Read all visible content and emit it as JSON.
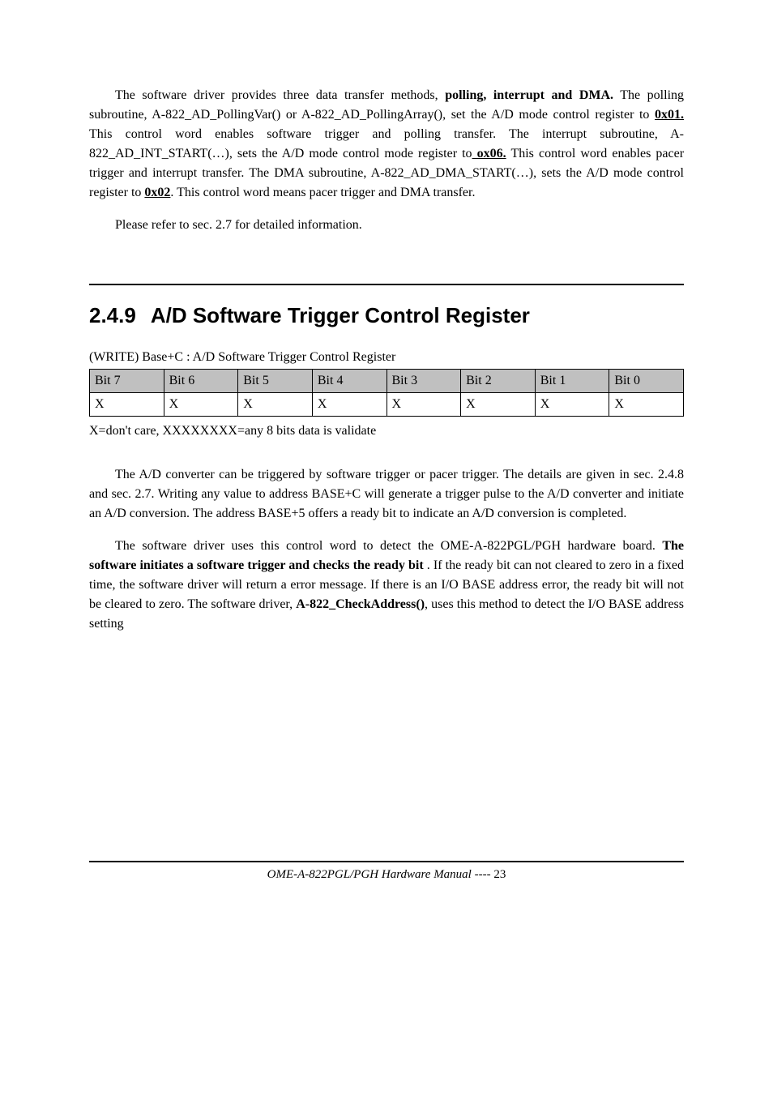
{
  "p1_a": "The software driver provides three data transfer methods, ",
  "p1_b": "polling, interrupt and DMA.",
  "p1_c": " The polling subroutine, A-822_AD_PollingVar() or A-822_AD_PollingArray(), set the A/D mode control register to ",
  "p1_d": "0x01.",
  "p1_e": "  This control word enables software trigger and polling transfer. The interrupt subroutine, A-822_AD_INT_START(…), sets the A/D mode control mode register to",
  "p1_f": " ox06.",
  "p1_g": " This control word enables pacer trigger and interrupt transfer. The DMA subroutine, A-822_AD_DMA_START(…), sets the A/D mode control register to ",
  "p1_h": "0x02",
  "p1_i": ". This control word means pacer trigger and DMA transfer.",
  "p2": "Please refer to sec. 2.7 for detailed information.",
  "section_num": "2.4.9",
  "section_title": "A/D Software Trigger Control Register",
  "table_caption": "(WRITE)   Base+C : A/D Software Trigger Control Register",
  "bits_header": [
    "Bit 7",
    "Bit 6",
    "Bit 5",
    "Bit 4",
    "Bit 3",
    "Bit 2",
    "Bit 1",
    "Bit 0"
  ],
  "bits_row": [
    "X",
    "X",
    "X",
    "X",
    "X",
    "X",
    "X",
    "X"
  ],
  "table_note": "X=don't care, XXXXXXXX=any 8 bits data is validate",
  "p3": "The A/D converter can be triggered by software trigger or pacer trigger.   The details are given in sec. 2.4.8 and sec. 2.7. Writing any value to address BASE+C will generate a trigger pulse to the A/D converter and initiate an A/D conversion.   The address BASE+5 offers a ready bit to indicate an A/D conversion is completed.",
  "p4_a": "The software driver uses this control word to detect the OME-A-822PGL/PGH hardware board. ",
  "p4_b": "The software initiates a software trigger and checks the ready bit",
  "p4_c": " . If the ready bit can not cleared to zero in a fixed time, the software driver will return a error message. If there is an I/O BASE address error, the ready bit will not be cleared to zero. The software driver, ",
  "p4_d": "A-822_CheckAddress()",
  "p4_e": ", uses this method to detect the I/O BASE address setting",
  "footer_italic": "OME-A-822PGL/PGH Hardware Manual",
  "footer_plain": "   ---- 23"
}
